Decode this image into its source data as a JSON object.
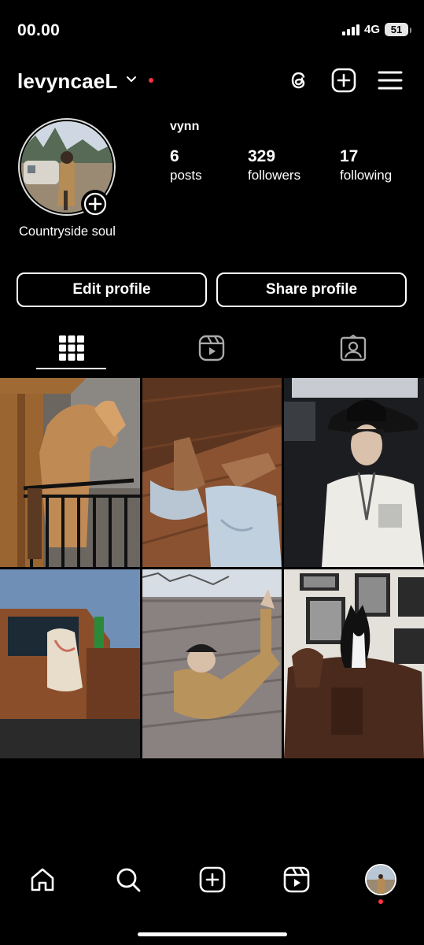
{
  "status_bar": {
    "time": "00.00",
    "network": "4G",
    "battery": "51"
  },
  "header": {
    "username": "levyncaeL",
    "icons": [
      "threads-icon",
      "create-icon",
      "menu-icon"
    ]
  },
  "profile": {
    "full_name": "vynn",
    "bio": "Countryside soul",
    "stats": [
      {
        "value": "6",
        "label": "posts"
      },
      {
        "value": "329",
        "label": "followers"
      },
      {
        "value": "17",
        "label": "following"
      }
    ]
  },
  "actions": {
    "edit": "Edit profile",
    "share": "Share profile"
  },
  "tabs": [
    "grid-icon",
    "reels-icon",
    "tagged-icon"
  ],
  "posts": [
    {
      "name": "horse-statue-post"
    },
    {
      "name": "cowboy-boots-post"
    },
    {
      "name": "cowboy-hat-portrait-post"
    },
    {
      "name": "vintage-truck-post"
    },
    {
      "name": "rooftop-lying-post"
    },
    {
      "name": "cat-on-saddle-post"
    }
  ],
  "bottom_nav": [
    "home-icon",
    "search-icon",
    "create-icon",
    "reels-icon",
    "profile-avatar"
  ],
  "colors": {
    "background": "#000000",
    "notification": "#ff3040",
    "text": "#ffffff"
  }
}
